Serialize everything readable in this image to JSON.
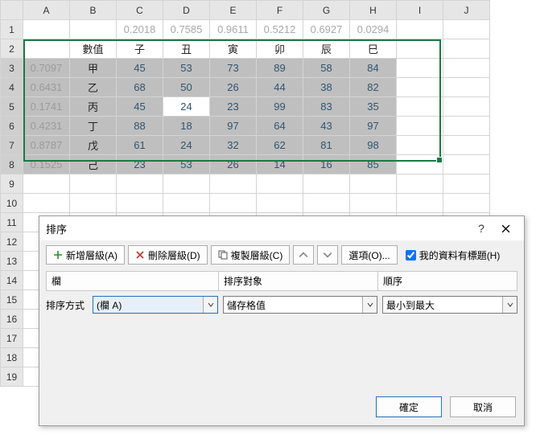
{
  "columns": [
    "A",
    "B",
    "C",
    "D",
    "E",
    "F",
    "G",
    "H",
    "I",
    "J"
  ],
  "rows": [
    "1",
    "2",
    "3",
    "4",
    "5",
    "6",
    "7",
    "8",
    "9",
    "10",
    "11",
    "12",
    "13",
    "14",
    "15",
    "16",
    "17",
    "18",
    "19"
  ],
  "row1": {
    "C": "0.2018",
    "D": "0.7585",
    "E": "0.9611",
    "F": "0.5212",
    "G": "0.6927",
    "H": "0.0294"
  },
  "row2": {
    "B": "數值",
    "C": "子",
    "D": "丑",
    "E": "寅",
    "F": "卯",
    "G": "辰",
    "H": "巳"
  },
  "data": [
    {
      "A": "0.7097",
      "B": "甲",
      "C": "45",
      "D": "53",
      "E": "73",
      "F": "89",
      "G": "58",
      "H": "84"
    },
    {
      "A": "0.6431",
      "B": "乙",
      "C": "68",
      "D": "50",
      "E": "26",
      "F": "44",
      "G": "38",
      "H": "82"
    },
    {
      "A": "0.1741",
      "B": "丙",
      "C": "45",
      "D": "24",
      "E": "23",
      "F": "99",
      "G": "83",
      "H": "35"
    },
    {
      "A": "0.4231",
      "B": "丁",
      "C": "88",
      "D": "18",
      "E": "97",
      "F": "64",
      "G": "43",
      "H": "97"
    },
    {
      "A": "0.8787",
      "B": "戊",
      "C": "61",
      "D": "24",
      "E": "32",
      "F": "62",
      "G": "81",
      "H": "98"
    },
    {
      "A": "0.1525",
      "B": "己",
      "C": "23",
      "D": "53",
      "E": "26",
      "F": "14",
      "G": "16",
      "H": "85"
    }
  ],
  "dialog": {
    "title": "排序",
    "help": "?",
    "toolbar": {
      "add": "新增層級(A)",
      "del": "刪除層級(D)",
      "copy": "複製層級(C)",
      "options": "選項(O)...",
      "header_chk": "我的資料有標題(H)"
    },
    "grid": {
      "h1": "欄",
      "h2": "排序對象",
      "h3": "順序",
      "label": "排序方式",
      "col": "(欄 A)",
      "on": "儲存格值",
      "order": "最小到最大"
    },
    "ok": "確定",
    "cancel": "取消"
  }
}
